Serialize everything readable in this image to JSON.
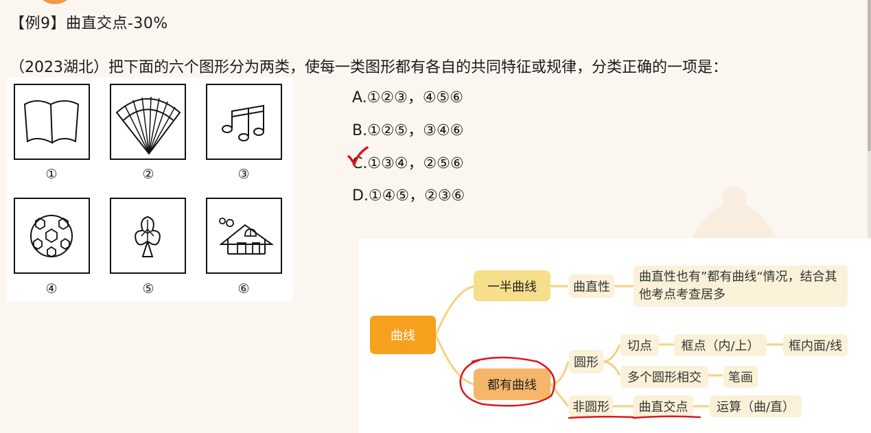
{
  "title": "【例9】曲直交点-30%",
  "question": "（2023湖北）把下面的六个图形分为两类，使每一类图形都有各自的共同特征或规律，分类正确的一项是：",
  "figures": [
    {
      "num": "①",
      "icon": "open-book-icon"
    },
    {
      "num": "②",
      "icon": "folding-fan-icon"
    },
    {
      "num": "③",
      "icon": "music-notes-icon"
    },
    {
      "num": "④",
      "icon": "soccer-ball-icon"
    },
    {
      "num": "⑤",
      "icon": "club-tree-icon"
    },
    {
      "num": "⑥",
      "icon": "house-icon"
    }
  ],
  "options": [
    {
      "label": "A.①②③，④⑤⑥"
    },
    {
      "label": "B.①②⑤，③④⑥"
    },
    {
      "label": "C.①③④，②⑤⑥",
      "marked": true
    },
    {
      "label": "D.①④⑤，②③⑥"
    }
  ],
  "mindmap": {
    "root": "曲线",
    "branch1": "一半曲线",
    "b1_child": "曲直性",
    "b1_leaf": "曲直性也有”都有曲线“情况，结合其他考点考查居多",
    "branch2": "都有曲线",
    "circle": "圆形",
    "tangent": "切点",
    "frame_point": "框点（内/上）",
    "frame_inside": "框内面/线",
    "multi_circle": "多个圆形相交",
    "strokes": "笔画",
    "non_circle": "非圆形",
    "curve_straight": "曲直交点",
    "operation": "运算（曲/直）"
  },
  "colors": {
    "root": "#f7a01d",
    "branch1": "#f6de8a",
    "branch2": "#f5b66a",
    "leaf": "#fbf1d9",
    "annotation": "#e0141e",
    "connector": "#f5d27d"
  }
}
